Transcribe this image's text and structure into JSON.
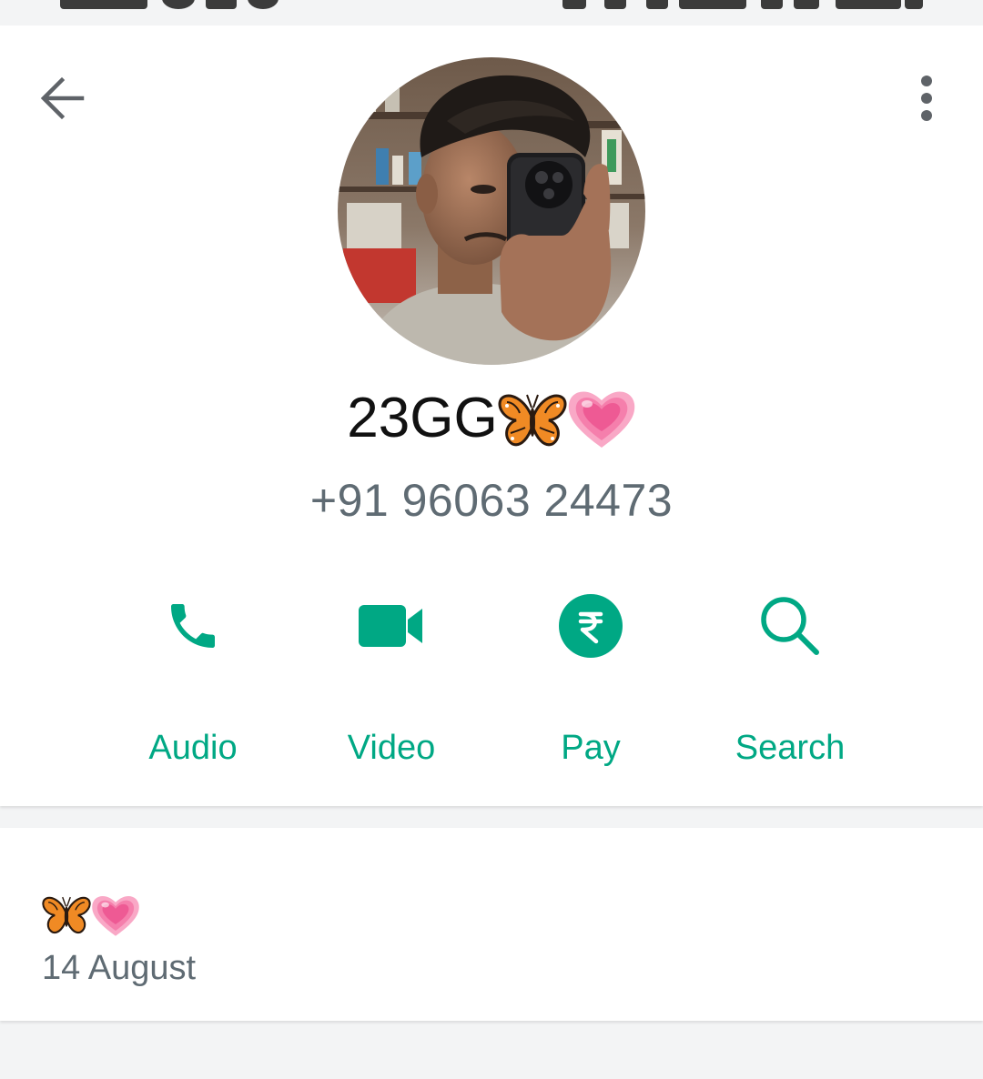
{
  "contact": {
    "name": "23GG",
    "name_emojis": [
      "butterfly",
      "growing-heart"
    ],
    "phone": "+91 96063 24473"
  },
  "actions": [
    {
      "label": "Audio",
      "icon": "phone-icon"
    },
    {
      "label": "Video",
      "icon": "video-camera-icon"
    },
    {
      "label": "Pay",
      "icon": "rupee-icon"
    },
    {
      "label": "Search",
      "icon": "search-icon"
    }
  ],
  "about": {
    "status_emojis": [
      "butterfly",
      "growing-heart"
    ],
    "date": "14 August"
  },
  "colors": {
    "accent": "#00a884",
    "secondary_text": "#5f6b73",
    "primary_text": "#111111",
    "icon_gray": "#5f6368",
    "page_background": "#f3f4f5"
  }
}
